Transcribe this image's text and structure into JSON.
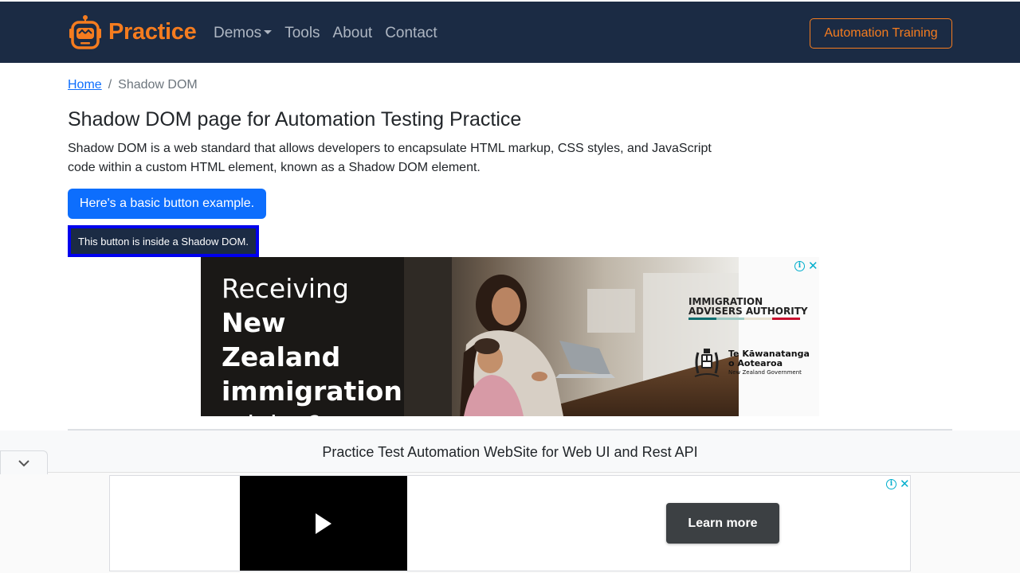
{
  "navbar": {
    "brand": "Practice",
    "brand_icon": "robot-logo-icon",
    "links": [
      {
        "label": "Demos",
        "has_caret": true
      },
      {
        "label": "Tools"
      },
      {
        "label": "About"
      },
      {
        "label": "Contact"
      }
    ],
    "training_button": "Automation Training"
  },
  "breadcrumb": {
    "home": "Home",
    "separator": "/",
    "current": "Shadow DOM"
  },
  "main": {
    "title": "Shadow DOM page for Automation Testing Practice",
    "description": "Shadow DOM is a web standard that allows developers to encapsulate HTML markup, CSS styles, and JavaScript code within a custom HTML element, known as a Shadow DOM element.",
    "basic_button": "Here's a basic button example.",
    "shadow_button": "This button is inside a Shadow DOM."
  },
  "ad_banner": {
    "line1": "Receiving",
    "line2": "New Zealand",
    "line3": "immigration",
    "line4": "advice?",
    "authority_line1": "IMMIGRATION",
    "authority_line2": "ADVISERS AUTHORITY",
    "gov_line1": "Te Kāwanatanga",
    "gov_line2": "o Aotearoa",
    "gov_line3": "New Zealand Government",
    "adchoices_icon": "info-icon",
    "close_icon": "close-icon"
  },
  "footer": {
    "text": "Practice Test Automation WebSite for Web UI and Rest API"
  },
  "anchor_ad": {
    "collapse_icon": "chevron-down-icon",
    "play_icon": "play-icon",
    "learn_more": "Learn more"
  },
  "colors": {
    "navbar_bg": "#1b2b44",
    "brand_orange": "#f57c1f",
    "primary_blue": "#0d6efd",
    "shadow_border": "#0000ee",
    "adchoices_cyan": "#00aecd"
  }
}
